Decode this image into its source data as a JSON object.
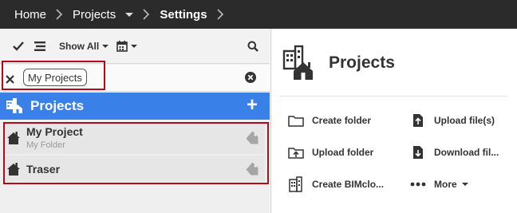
{
  "breadcrumb": {
    "home": "Home",
    "projects": "Projects",
    "settings": "Settings"
  },
  "toolbar": {
    "show_all": "Show All"
  },
  "filter": {
    "chip_label": "My Projects"
  },
  "sidebar": {
    "section_title": "Projects",
    "projects": [
      {
        "name": "My Project",
        "subtitle": "My Folder"
      },
      {
        "name": "Traser",
        "subtitle": ""
      }
    ]
  },
  "details": {
    "title": "Projects",
    "actions": {
      "create_folder": "Create folder",
      "upload_files": "Upload file(s)",
      "upload_folder": "Upload folder",
      "download_files": "Download fil...",
      "create_bimcloud": "Create BIMclo...",
      "more": "More"
    }
  },
  "colors": {
    "topbar": "#2b2b2b",
    "accent_blue": "#3a80e9",
    "highlight_red": "#b00a1b"
  }
}
